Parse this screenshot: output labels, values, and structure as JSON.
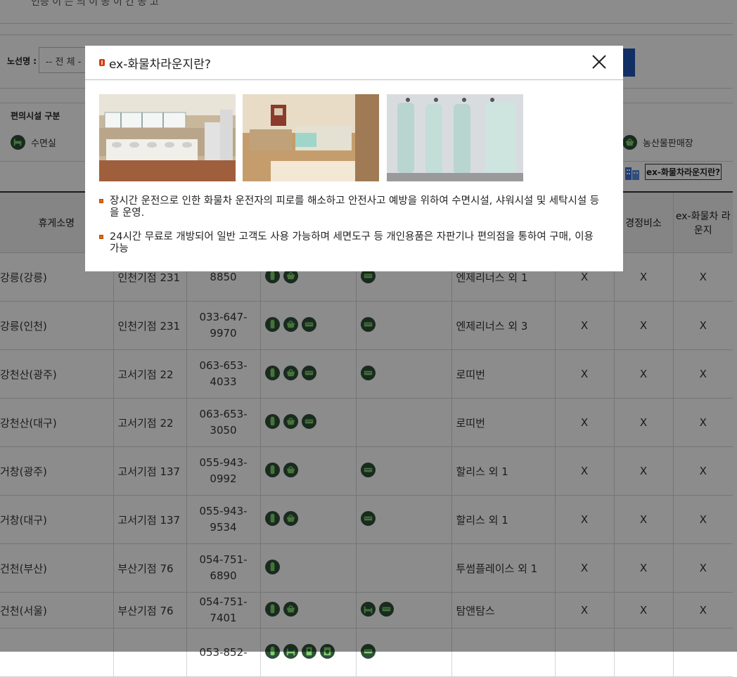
{
  "topbar": {
    "text": "인증 이 는 의 이 공 이 간 공 고"
  },
  "route": {
    "label": "노선명 :",
    "selected": "-- 전 체 -"
  },
  "facility": {
    "title": "편의시설 구분",
    "items": [
      {
        "label": "수면실",
        "icon": "bed-icon"
      },
      {
        "label": "농산물판매장",
        "icon": "basket-icon"
      }
    ],
    "lounge_button": "ex-화물차라운지란?"
  },
  "table": {
    "headers": [
      "휴게소명",
      "",
      "",
      "",
      "",
      "",
      "",
      "경정비소",
      "ex-화물차 라운지"
    ],
    "rows": [
      {
        "name": "강릉(강릉)",
        "location": "인천기점 231",
        "tel": "8850",
        "icons": [
          "shower-icon",
          "basket-icon"
        ],
        "icons2": [
          "bed-icon"
        ],
        "brand": "엔제리너스 외 1",
        "x1": "X",
        "x2": "X",
        "x3": "X"
      },
      {
        "name": "강릉(인천)",
        "location": "인천기점 231",
        "tel": "033-647-9970",
        "icons": [
          "shower-icon",
          "basket-icon",
          "bed-icon"
        ],
        "icons2": [
          "bed-icon"
        ],
        "brand": "엔제리너스 외 3",
        "x1": "X",
        "x2": "X",
        "x3": "X"
      },
      {
        "name": "강천산(광주)",
        "location": "고서기점 22",
        "tel": "063-653-4033",
        "icons": [
          "shower-icon",
          "basket-icon",
          "bed-icon"
        ],
        "icons2": [
          "bed-icon"
        ],
        "brand": "로띠번",
        "x1": "X",
        "x2": "X",
        "x3": "X"
      },
      {
        "name": "강천산(대구)",
        "location": "고서기점 22",
        "tel": "063-653-3050",
        "icons": [
          "shower-icon",
          "basket-icon",
          "bed-icon"
        ],
        "icons2": [],
        "brand": "로띠번",
        "x1": "X",
        "x2": "X",
        "x3": "X"
      },
      {
        "name": "거창(광주)",
        "location": "고서기점 137",
        "tel": "055-943-0992",
        "icons": [
          "shower-icon",
          "basket-icon"
        ],
        "icons2": [
          "bed-icon"
        ],
        "brand": "할리스 외 1",
        "x1": "X",
        "x2": "X",
        "x3": "X"
      },
      {
        "name": "거창(대구)",
        "location": "고서기점 137",
        "tel": "055-943-9534",
        "icons": [
          "shower-icon",
          "basket-icon"
        ],
        "icons2": [
          "bed-icon"
        ],
        "brand": "할리스 외 1",
        "x1": "X",
        "x2": "X",
        "x3": "X"
      },
      {
        "name": "건천(부산)",
        "location": "부산기점 76",
        "tel": "054-751-6890",
        "icons": [
          "shower-icon"
        ],
        "icons2": [],
        "brand": "투썸플레이스 외 1",
        "x1": "X",
        "x2": "X",
        "x3": "X"
      },
      {
        "name": "건천(서울)",
        "location": "부산기점 76",
        "tel": "054-751-7401",
        "icons": [
          "shower-icon",
          "basket-icon"
        ],
        "icons2": [
          "bench-icon",
          "bed-icon"
        ],
        "brand": "탐앤탐스",
        "x1": "X",
        "x2": "X",
        "x3": "X"
      },
      {
        "name": "",
        "location": "",
        "tel": "053-852-",
        "icons": [
          "shower-icon",
          "bench-icon",
          "vending-icon",
          "laundry-icon"
        ],
        "icons2": [
          "bed-icon"
        ],
        "brand": "",
        "x1": "",
        "x2": "",
        "x3": ""
      }
    ]
  },
  "modal": {
    "title": "ex-화물차라운지란?",
    "close_icon": "close-icon",
    "photos": [
      "laundry-room-photo",
      "sleeping-room-photo",
      "shower-room-photo"
    ],
    "paragraphs": [
      "장시간 운전으로 인한 화물차 운전자의 피로를 해소하고 안전사고 예방을 위하여 수면시설, 샤워시설 및 세탁시설 등을 운영.",
      "24시간 무료로 개방되어 일반 고객도 사용 가능하며 세면도구 등 개인용품은 자판기나 편의점을 통하여 구매, 이용 가능"
    ]
  },
  "colors": {
    "icon_bg": "#2f4f3a",
    "icon_fg": "#7fd16b",
    "accent_blue": "#1f57b8",
    "bullet_red": "#d23b1d"
  }
}
